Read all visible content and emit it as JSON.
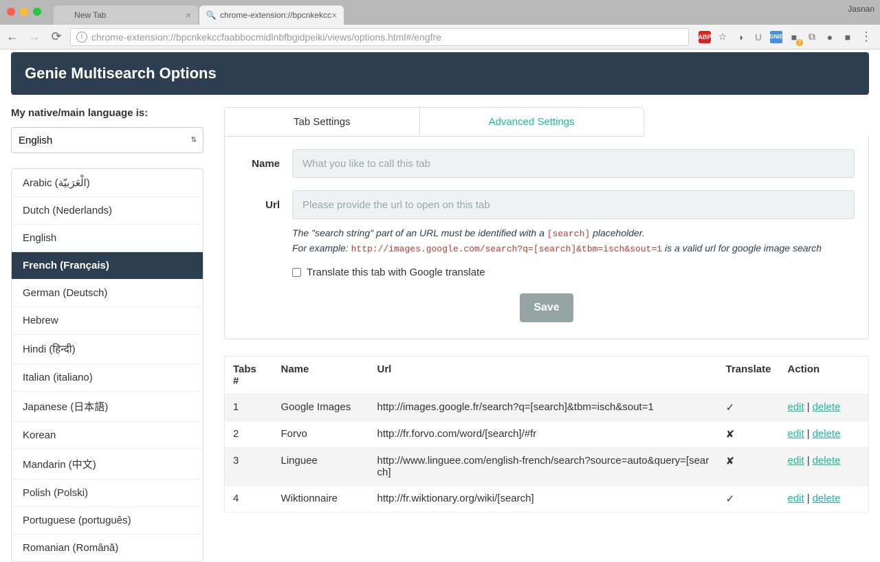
{
  "browser": {
    "user_label": "Jasnan",
    "tabs": [
      {
        "title": "New Tab",
        "active": false
      },
      {
        "title": "chrome-extension://bpcnkekcc",
        "active": true
      }
    ],
    "url": "chrome-extension://bpcnkekccfaabbocmidlnbfbgidpeiki/views/options.html#/engfre",
    "abp_label": "ABP",
    "gnie_label": "GNIE"
  },
  "header": {
    "title": "Genie Multisearch Options"
  },
  "sidebar": {
    "label": "My native/main language is:",
    "selected_language": "English",
    "languages": [
      "Arabic (الْعَرَبيّة)",
      "Dutch (Nederlands)",
      "English",
      "French (Français)",
      "German (Deutsch)",
      "Hebrew",
      "Hindi (हिन्दी)",
      "Italian (italiano)",
      "Japanese (日本語)",
      "Korean",
      "Mandarin (中文)",
      "Polish (Polski)",
      "Portuguese (português)",
      "Romanian (Română)"
    ],
    "active_index": 3
  },
  "main_tabs": {
    "tab_settings": "Tab Settings",
    "advanced_settings": "Advanced Settings",
    "active_index": 1
  },
  "form": {
    "name_label": "Name",
    "name_placeholder": "What you like to call this tab",
    "name_value": "",
    "url_label": "Url",
    "url_placeholder": "Please provide the url to open on this tab",
    "url_value": "",
    "helper_prefix": "The \"search string\" part of an URL must be identified with a ",
    "helper_code1": "[search]",
    "helper_mid": " placeholder.",
    "helper_example_prefix": "For example: ",
    "helper_code2": "http://images.google.com/search?q=[search]&tbm=isch&sout=1",
    "helper_example_suffix": " is a valid url for google image search",
    "translate_checkbox_label": "Translate this tab with Google translate",
    "save_label": "Save"
  },
  "table": {
    "headers": {
      "tabs_no": "Tabs #",
      "name": "Name",
      "url": "Url",
      "translate": "Translate",
      "action": "Action"
    },
    "edit_label": "edit",
    "delete_label": "delete",
    "rows": [
      {
        "no": "1",
        "name": "Google Images",
        "url": "http://images.google.fr/search?q=[search]&tbm=isch&sout=1",
        "translate": "✓"
      },
      {
        "no": "2",
        "name": "Forvo",
        "url": "http://fr.forvo.com/word/[search]/#fr",
        "translate": "✘"
      },
      {
        "no": "3",
        "name": "Linguee",
        "url": "http://www.linguee.com/english-french/search?source=auto&query=[search]",
        "translate": "✘"
      },
      {
        "no": "4",
        "name": "Wiktionnaire",
        "url": "http://fr.wiktionary.org/wiki/[search]",
        "translate": "✓"
      }
    ]
  }
}
